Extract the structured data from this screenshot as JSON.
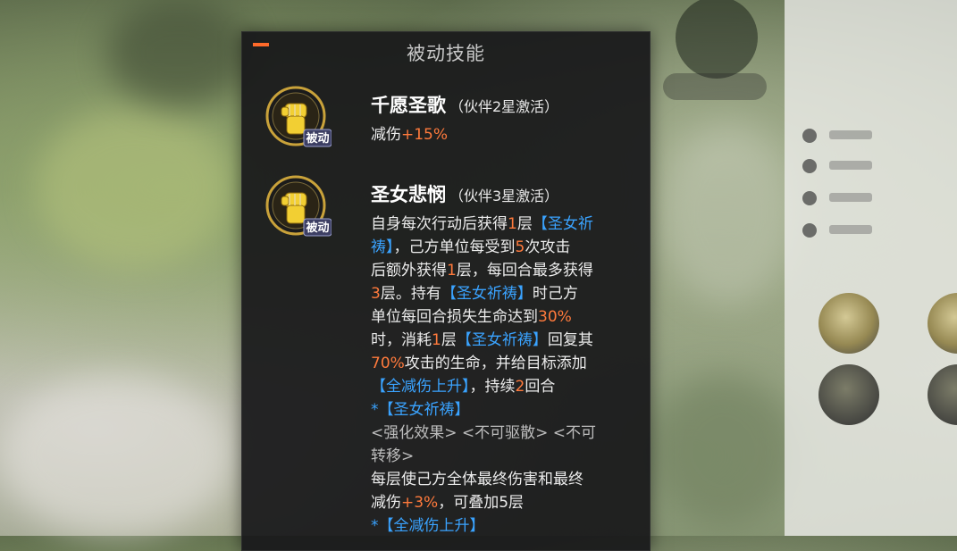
{
  "panel": {
    "title": "被动技能"
  },
  "skills": [
    {
      "name": "千愿圣歌",
      "activation": "（伙伴2星激活）",
      "badge": "被动",
      "effect_label": "减伤",
      "effect_value": "+15%"
    },
    {
      "name": "圣女悲悯",
      "activation": "（伙伴3星激活）",
      "badge": "被动",
      "desc": {
        "l1a": "自身每次行动后获得",
        "l1b": "1",
        "l1c": "层",
        "l1d": "【圣女祈",
        "l2a": "祷】",
        "l2b": "，己方单位每受到",
        "l2c": "5",
        "l2d": "次攻击",
        "l3a": "后额外获得",
        "l3b": "1",
        "l3c": "层，每回合最多获得",
        "l4a": "3",
        "l4b": "层。持有",
        "l4c": "【圣女祈祷】",
        "l4d": "时己方",
        "l5a": "单位每回合损失生命达到",
        "l5b": "30%",
        "l6a": "时，消耗",
        "l6b": "1",
        "l6c": "层",
        "l6d": "【圣女祈祷】",
        "l6e": "回复其",
        "l7a": "70%",
        "l7b": "攻击的生命，并给目标添加",
        "l8a": "【全减伤上升】",
        "l8b": "，持续",
        "l8c": "2",
        "l8d": "回合",
        "l9": "*【圣女祈祷】",
        "l10": "<强化效果> <不可驱散> <不可",
        "l11": "转移>",
        "l12": "每层使己方全体最终伤害和最终",
        "l13a": "减伤",
        "l13b": "+3%",
        "l13c": "，可叠加5层",
        "l14": "*【全减伤上升】"
      }
    }
  ],
  "colors": {
    "accent_orange": "#ff7a3c",
    "tag_blue": "#3aa3ff",
    "panel_bg": "#18181a"
  },
  "icons": [
    "raised-fist-icon",
    "raised-fist-icon"
  ]
}
